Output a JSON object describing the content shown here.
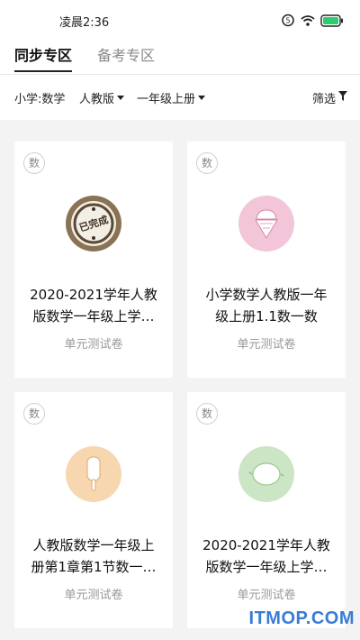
{
  "status_bar": {
    "time": "凌晨2:36"
  },
  "tabs": [
    {
      "label": "同步专区",
      "active": true
    },
    {
      "label": "备考专区",
      "active": false
    }
  ],
  "filters": {
    "subject": "小学:数学",
    "edition": "人教版",
    "grade": "一年级上册",
    "screen": "筛选"
  },
  "cards": [
    {
      "badge": "数",
      "title": "2020-2021学年人教\n版数学一年级上学…",
      "type": "单元测试卷",
      "icon": "completed-stamp-icon",
      "stamp_text": "已完成",
      "color": "#8a7355"
    },
    {
      "badge": "数",
      "title": "小学数学人教版一年\n级上册1.1数一数",
      "type": "单元测试卷",
      "icon": "ice-cream-cone-icon",
      "color": "#f2c6d8"
    },
    {
      "badge": "数",
      "title": "人教版数学一年级上\n册第1章第1节数一…",
      "type": "单元测试卷",
      "icon": "popsicle-icon",
      "color": "#f7d7b0"
    },
    {
      "badge": "数",
      "title": "2020-2021学年人教\n版数学一年级上学…",
      "type": "单元测试卷",
      "icon": "lemon-icon",
      "color": "#cce5c4"
    }
  ],
  "watermark": "ITMOP.COM",
  "colors": {
    "accent": "#222222",
    "background": "#f3f3f3",
    "card": "#ffffff",
    "battery": "#2ecc71"
  }
}
